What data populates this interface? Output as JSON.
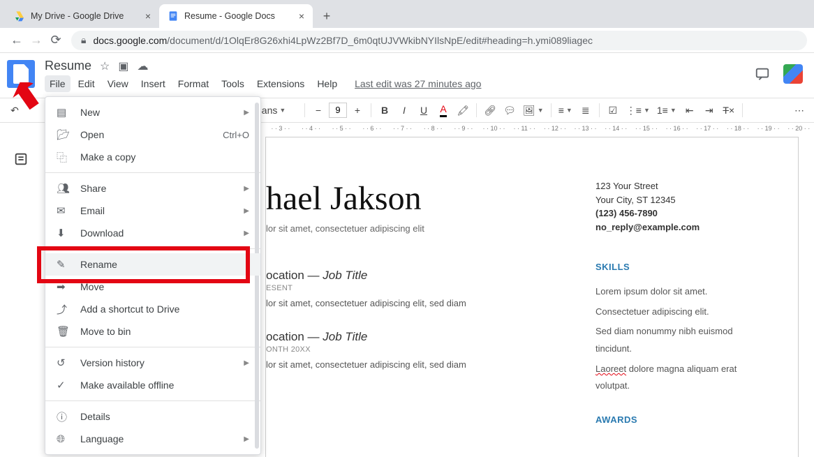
{
  "browser": {
    "tabs": [
      {
        "title": "My Drive - Google Drive"
      },
      {
        "title": "Resume - Google Docs"
      }
    ],
    "url_domain": "docs.google.com",
    "url_path": "/document/d/1OlqEr8G26xhi4LpWz2Bf7D_6m0qtUJVWkibNYIlsNpE/edit#heading=h.ymi089liagec"
  },
  "header": {
    "doc_title": "Resume",
    "menus": [
      "File",
      "Edit",
      "View",
      "Insert",
      "Format",
      "Tools",
      "Extensions",
      "Help"
    ],
    "last_edit": "Last edit was 27 minutes ago"
  },
  "toolbar": {
    "font_name": "en Sans",
    "font_size": "9"
  },
  "file_menu": {
    "items": [
      {
        "icon": "doc",
        "label": "New",
        "arrow": true
      },
      {
        "icon": "folder-open",
        "label": "Open",
        "shortcut": "Ctrl+O"
      },
      {
        "icon": "copy",
        "label": "Make a copy"
      },
      {
        "div": true
      },
      {
        "icon": "share",
        "label": "Share",
        "arrow": true
      },
      {
        "icon": "mail",
        "label": "Email",
        "arrow": true
      },
      {
        "icon": "download",
        "label": "Download",
        "arrow": true
      },
      {
        "div": true
      },
      {
        "icon": "pencil",
        "label": "Rename",
        "hl": true
      },
      {
        "icon": "move",
        "label": "Move"
      },
      {
        "icon": "shortcut",
        "label": "Add a shortcut to Drive"
      },
      {
        "icon": "trash",
        "label": "Move to bin"
      },
      {
        "div": true
      },
      {
        "icon": "history",
        "label": "Version history",
        "arrow": true
      },
      {
        "icon": "offline",
        "label": "Make available offline"
      },
      {
        "div": true
      },
      {
        "icon": "info",
        "label": "Details"
      },
      {
        "icon": "globe",
        "label": "Language",
        "arrow": true
      }
    ]
  },
  "document": {
    "name": "hael Jakson",
    "tagline": "lor sit amet, consectetuer adipiscing elit",
    "contact": {
      "street": "123 Your Street",
      "city": "Your City, ST 12345",
      "phone": "(123) 456-7890",
      "email": "no_reply@example.com"
    },
    "jobs": [
      {
        "heading_left": "ocation — ",
        "heading_title": "Job Title",
        "date": "ESENT",
        "body": "lor sit amet, consectetuer adipiscing elit, sed diam"
      },
      {
        "heading_left": "ocation — ",
        "heading_title": "Job Title",
        "date": "ONTH 20XX",
        "body": "lor sit amet, consectetuer adipiscing elit, sed diam"
      }
    ],
    "skills_h": "SKILLS",
    "skills": [
      "Lorem ipsum dolor sit amet.",
      "Consectetuer adipiscing elit.",
      "Sed diam nonummy nibh euismod tincidunt.",
      {
        "underlined": "Laoreet",
        "rest": " dolore magna aliquam erat volutpat."
      }
    ],
    "awards_h": "AWARDS"
  },
  "ruler_marks": [
    "3",
    "4",
    "5",
    "6",
    "7",
    "8",
    "9",
    "10",
    "11",
    "12",
    "13",
    "14",
    "15",
    "16",
    "17",
    "18",
    "19",
    "20"
  ]
}
